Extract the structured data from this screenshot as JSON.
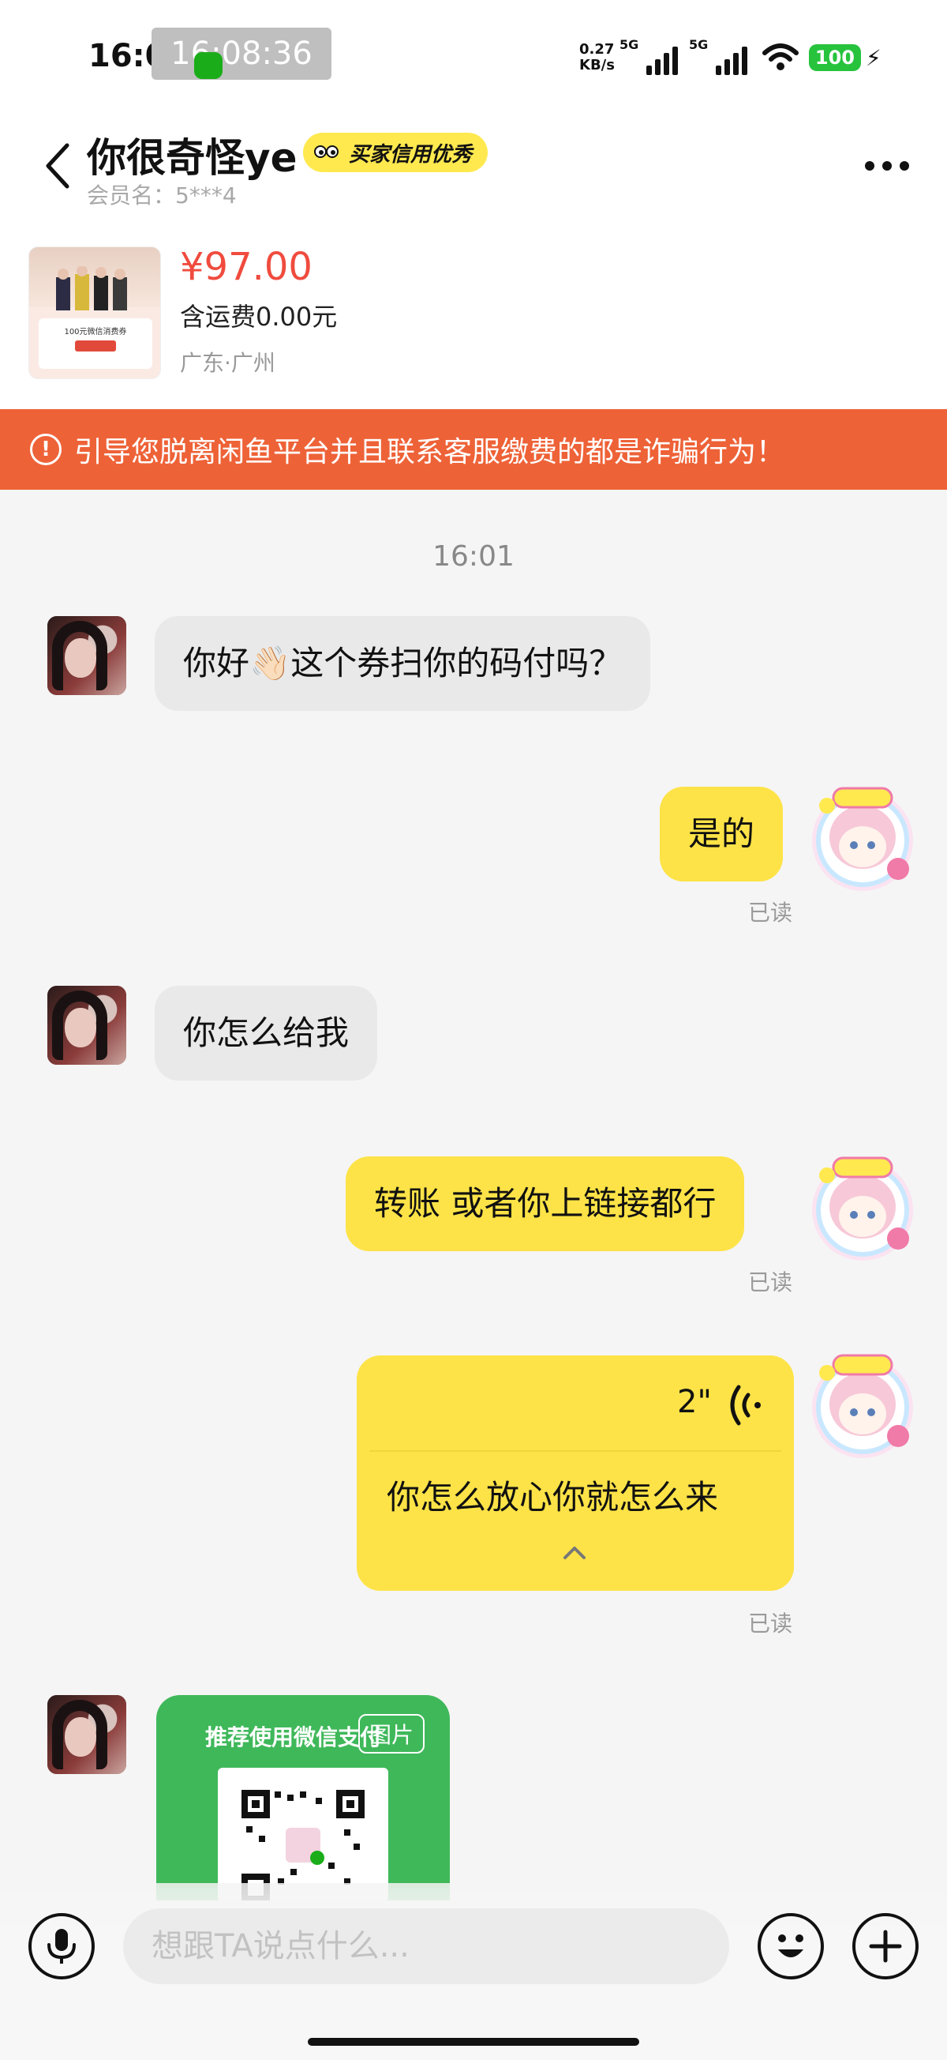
{
  "status_bar": {
    "time": "16:08",
    "screenshot_time": "16:08:36",
    "net_speed_value": "0.27",
    "net_speed_unit": "KB/s",
    "sim1_label": "5G",
    "sim2_label": "5G",
    "battery": "100",
    "battery_color": "#27c33d"
  },
  "header": {
    "title": "你很奇怪ye",
    "credit_badge": "买家信用优秀",
    "member_name": "会员名：5***4"
  },
  "product": {
    "price": "¥97.00",
    "shipping": "含运费0.00元",
    "location": "广东·广州",
    "thumb_text": "100元微信消费券"
  },
  "warning": {
    "text": "引导您脱离闲鱼平台并且联系客服缴费的都是诈骗行为！",
    "color": "#ee6237"
  },
  "chat": {
    "timestamp": "16:01",
    "messages": [
      {
        "side": "in",
        "text": "你好👋🏻这个券扫你的码付吗？"
      },
      {
        "side": "out",
        "text": "是的",
        "status": "已读"
      },
      {
        "side": "in",
        "text": "你怎么给我"
      },
      {
        "side": "out",
        "text": "转账 或者你上链接都行",
        "status": "已读"
      },
      {
        "side": "out",
        "type": "voice",
        "duration": "2\"",
        "transcript": "你怎么放心你就怎么来",
        "status": "已读"
      },
      {
        "side": "in",
        "type": "image",
        "title": "推荐使用微信支付",
        "tag": "图片"
      }
    ]
  },
  "input_bar": {
    "placeholder": "想跟TA说点什么..."
  },
  "icons": {
    "back": "back-arrow-icon",
    "more": "more-dots-icon",
    "mic": "microphone-icon",
    "emoji": "emoji-icon",
    "plus": "plus-icon",
    "voice": "voice-wave-icon"
  },
  "colors": {
    "outgoing_bubble": "#fde347",
    "incoming_bubble": "#e9e9e9",
    "price": "#f04b3e",
    "badge": "#ffe94f",
    "qr_card": "#3fb85a"
  }
}
